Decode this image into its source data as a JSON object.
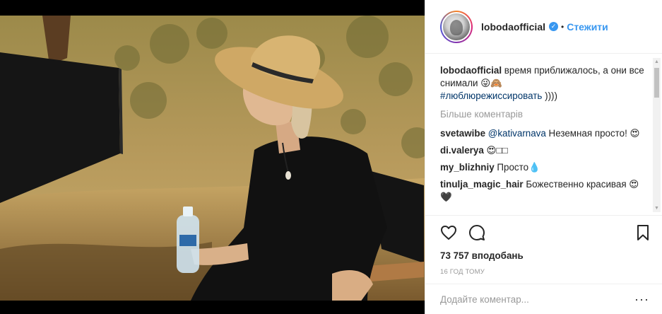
{
  "post": {
    "username": "lobodaofficial",
    "verified_mark": "✓",
    "separator": "•",
    "follow_label": "Стежити"
  },
  "caption": {
    "username": "lobodaofficial",
    "text": " время приближалось, а они все снимали 😜🙈",
    "hashtag": "#люблюрежиссировать",
    "tail": " ))))"
  },
  "more_comments_label": "Більше коментарів",
  "comments": [
    {
      "user": "svetawibe",
      "mention": "@kativarnava",
      "text": " Неземная просто! 😍"
    },
    {
      "user": "di.valerya",
      "mention": "",
      "text": " 😍□□"
    },
    {
      "user": "my_blizhniy",
      "mention": "",
      "text": " Просто💧"
    },
    {
      "user": "tinulja_magic_hair",
      "mention": "",
      "text": " Божественно красивая 😍🖤"
    }
  ],
  "icons": {
    "like": "heart-icon",
    "comment": "comment-icon",
    "save": "bookmark-icon",
    "more": "more-options-icon"
  },
  "likes": "73 757 вподобань",
  "timestamp": "16 ГОД ТОМУ",
  "add_comment": {
    "placeholder": "Додайте коментар...",
    "more": "···"
  },
  "colors": {
    "link": "#3897f0",
    "hashtag": "#003569",
    "muted": "#999999",
    "border": "#efefef"
  }
}
